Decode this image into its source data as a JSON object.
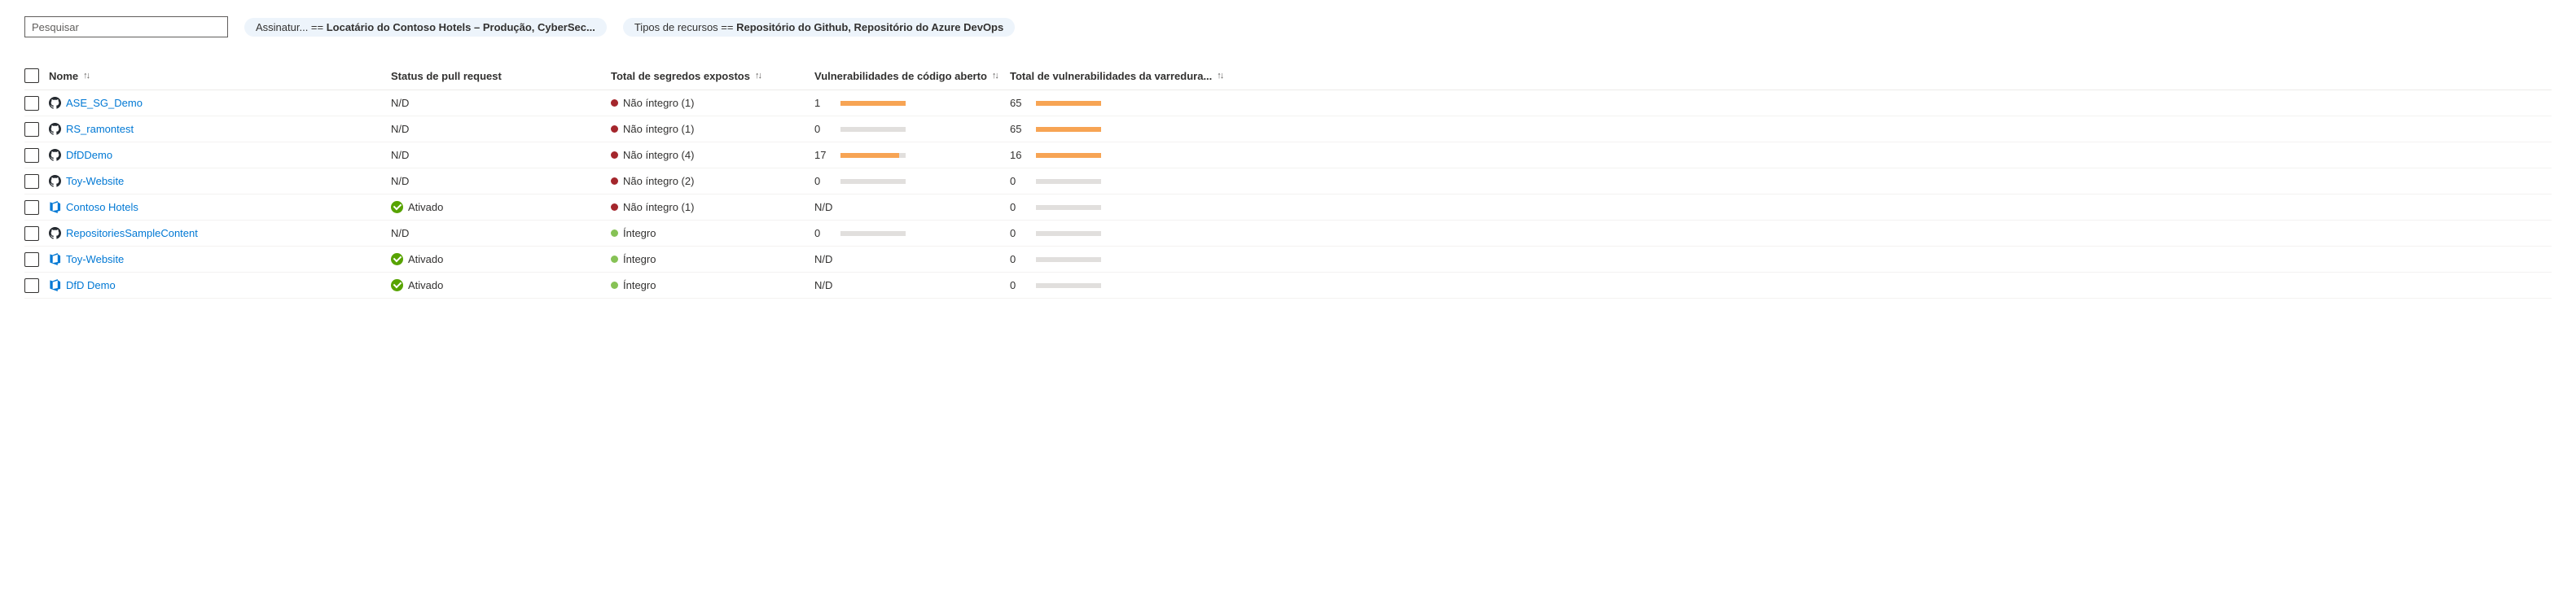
{
  "search": {
    "placeholder": "Pesquisar"
  },
  "filters": [
    {
      "prefix": "Assinatur... == ",
      "bold": "Locatário do Contoso Hotels – Produção, CyberSec..."
    },
    {
      "prefix": "Tipos de recursos == ",
      "bold": "Repositório do Github, Repositório do Azure DevOps"
    }
  ],
  "columns": {
    "name": "Nome",
    "pr_status": "Status de pull request",
    "secrets": "Total de segredos expostos",
    "oss_vuln": "Vulnerabilidades de código aberto",
    "scan_vuln": "Total de vulnerabilidades da varredura..."
  },
  "sort_glyph": "↑↓",
  "rows": [
    {
      "icon": "github",
      "name": "ASE_SG_Demo",
      "pr_status": {
        "kind": "text",
        "text": "N/D"
      },
      "secrets": {
        "dot": "red",
        "text": "Não íntegro (1)"
      },
      "oss": {
        "kind": "bar",
        "value": "1",
        "track": true,
        "segments": [
          [
            "o",
            100
          ]
        ]
      },
      "scan": {
        "kind": "bar",
        "value": "65",
        "track": true,
        "segments": [
          [
            "o",
            100
          ]
        ]
      }
    },
    {
      "icon": "github",
      "name": "RS_ramontest",
      "pr_status": {
        "kind": "text",
        "text": "N/D"
      },
      "secrets": {
        "dot": "red",
        "text": "Não íntegro (1)"
      },
      "oss": {
        "kind": "bar",
        "value": "0",
        "track": true,
        "segments": []
      },
      "scan": {
        "kind": "bar",
        "value": "65",
        "track": true,
        "segments": [
          [
            "o",
            100
          ]
        ]
      }
    },
    {
      "icon": "github",
      "name": "DfDDemo",
      "pr_status": {
        "kind": "text",
        "text": "N/D"
      },
      "secrets": {
        "dot": "red",
        "text": "Não íntegro (4)"
      },
      "oss": {
        "kind": "bar",
        "value": "17",
        "track": true,
        "segments": [
          [
            "r",
            75
          ],
          [
            "o",
            90
          ]
        ]
      },
      "scan": {
        "kind": "bar",
        "value": "16",
        "track": true,
        "segments": [
          [
            "o",
            100
          ]
        ]
      }
    },
    {
      "icon": "github",
      "name": "Toy-Website",
      "pr_status": {
        "kind": "text",
        "text": "N/D"
      },
      "secrets": {
        "dot": "red",
        "text": "Não íntegro (2)"
      },
      "oss": {
        "kind": "bar",
        "value": "0",
        "track": true,
        "segments": []
      },
      "scan": {
        "kind": "bar",
        "value": "0",
        "track": true,
        "segments": []
      }
    },
    {
      "icon": "devops",
      "name": "Contoso Hotels",
      "pr_status": {
        "kind": "check",
        "text": "Ativado"
      },
      "secrets": {
        "dot": "red",
        "text": "Não íntegro (1)"
      },
      "oss": {
        "kind": "text",
        "value": "N/D"
      },
      "scan": {
        "kind": "bar",
        "value": "0",
        "track": true,
        "segments": []
      }
    },
    {
      "icon": "github",
      "name": "RepositoriesSampleContent",
      "pr_status": {
        "kind": "text",
        "text": "N/D"
      },
      "secrets": {
        "dot": "green",
        "text": "Íntegro"
      },
      "oss": {
        "kind": "bar",
        "value": "0",
        "track": true,
        "segments": []
      },
      "scan": {
        "kind": "bar",
        "value": "0",
        "track": true,
        "segments": []
      }
    },
    {
      "icon": "devops",
      "name": "Toy-Website",
      "pr_status": {
        "kind": "check",
        "text": "Ativado"
      },
      "secrets": {
        "dot": "green",
        "text": "Íntegro"
      },
      "oss": {
        "kind": "text",
        "value": "N/D"
      },
      "scan": {
        "kind": "bar",
        "value": "0",
        "track": true,
        "segments": []
      }
    },
    {
      "icon": "devops",
      "name": "DfD Demo",
      "pr_status": {
        "kind": "check",
        "text": "Ativado"
      },
      "secrets": {
        "dot": "green",
        "text": "Íntegro"
      },
      "oss": {
        "kind": "text",
        "value": "N/D"
      },
      "scan": {
        "kind": "bar",
        "value": "0",
        "track": true,
        "segments": []
      }
    }
  ]
}
